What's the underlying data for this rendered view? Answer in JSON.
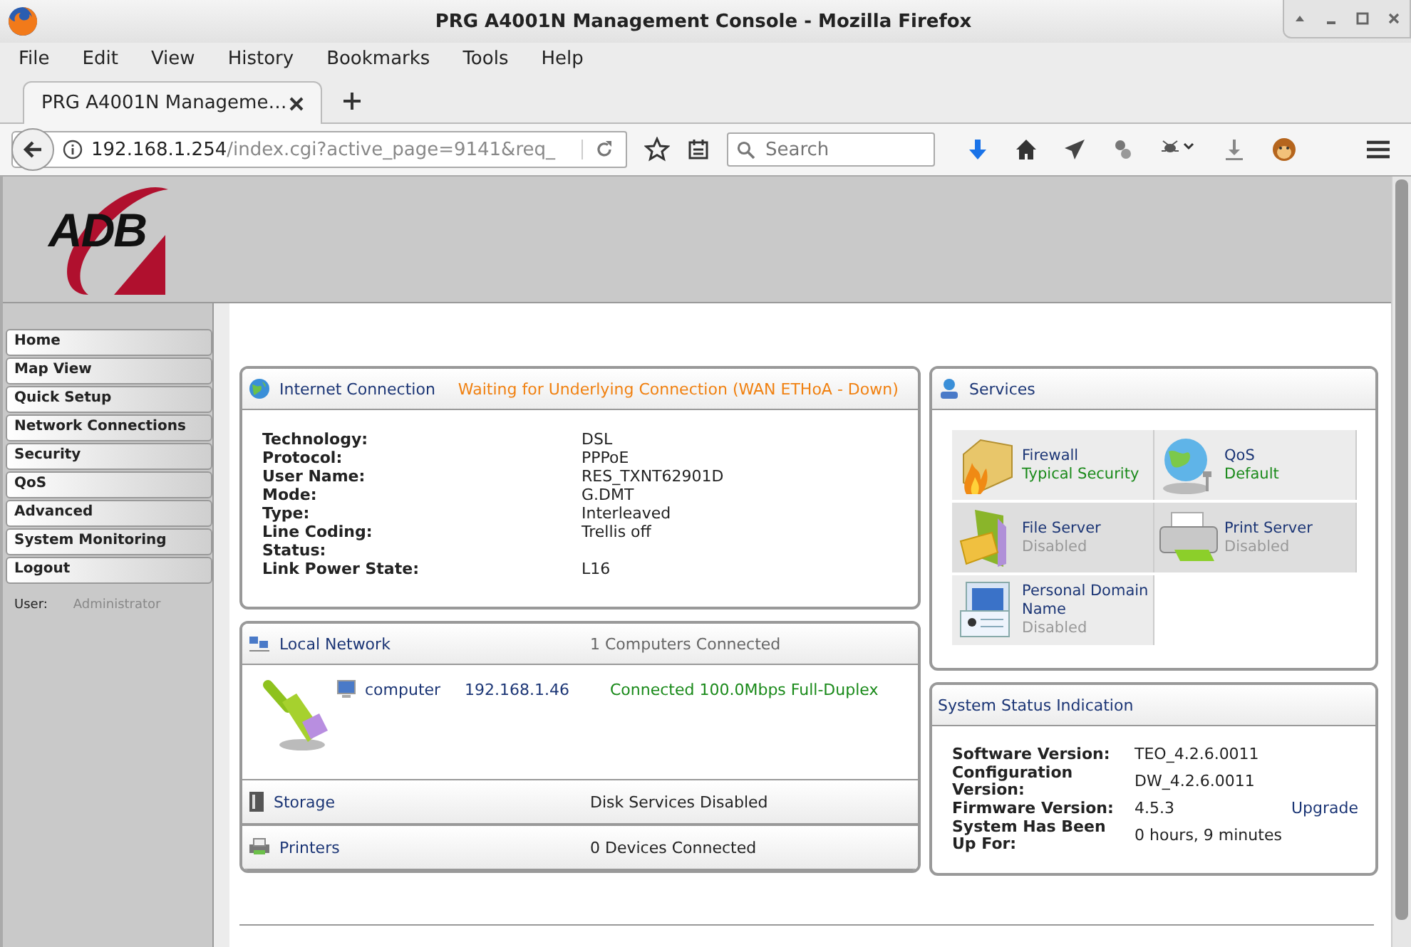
{
  "window": {
    "title": "PRG A4001N Management Console - Mozilla Firefox"
  },
  "menu": [
    "File",
    "Edit",
    "View",
    "History",
    "Bookmarks",
    "Tools",
    "Help"
  ],
  "tabs": [
    {
      "label": "PRG A4001N Manageme…",
      "selected": true
    }
  ],
  "address": {
    "host": "192.168.1.254",
    "path": "/index.cgi?active_page=9141&req_"
  },
  "search": {
    "placeholder": "Search"
  },
  "logo": "ADB",
  "sidebar": {
    "items": [
      "Home",
      "Map View",
      "Quick Setup",
      "Network Connections",
      "Security",
      "QoS",
      "Advanced",
      "System Monitoring",
      "Logout"
    ],
    "user_label": "User:",
    "user": "Administrator"
  },
  "internet": {
    "title": "Internet Connection",
    "status": "Waiting for Underlying Connection (WAN ETHoA - Down)",
    "fields": [
      {
        "label": "Technology:",
        "value": "DSL"
      },
      {
        "label": "Protocol:",
        "value": "PPPoE"
      },
      {
        "label": "User Name:",
        "value": "RES_TXNT62901D"
      },
      {
        "label": "Mode:",
        "value": "G.DMT"
      },
      {
        "label": "Type:",
        "value": "Interleaved"
      },
      {
        "label": "Line Coding:",
        "value": "Trellis off"
      },
      {
        "label": "Status:"
      },
      {
        "label": "Link Power State:",
        "value": "L16"
      }
    ]
  },
  "local_network": {
    "title": "Local Network",
    "summary": "1 Computers Connected",
    "devices": [
      {
        "name": "computer",
        "ip": "192.168.1.46",
        "status": "Connected 100.0Mbps Full-Duplex"
      }
    ]
  },
  "storage": {
    "title": "Storage",
    "summary": "Disk Services Disabled"
  },
  "printers": {
    "title": "Printers",
    "summary": "0 Devices Connected"
  },
  "services": {
    "title": "Services",
    "items": [
      {
        "kind": "firewall",
        "name": "Firewall",
        "status": "Typical Security",
        "enabled": true
      },
      {
        "kind": "qos",
        "name": "QoS",
        "status": "Default",
        "enabled": true
      },
      {
        "kind": "file",
        "name": "File Server",
        "status": "Disabled",
        "enabled": false
      },
      {
        "kind": "print",
        "name": "Print Server",
        "status": "Disabled",
        "enabled": false
      },
      {
        "kind": "domain",
        "name": "Personal Domain Name",
        "status": "Disabled",
        "enabled": false
      }
    ]
  },
  "system_status": {
    "title": "System Status Indication",
    "fields": [
      {
        "label": "Software Version:",
        "value": "TEO_4.2.6.0011"
      },
      {
        "label": "Configuration Version:",
        "value": "DW_4.2.6.0011"
      },
      {
        "label": "Firmware Version:",
        "value": "4.5.3",
        "link": "Upgrade"
      },
      {
        "label": "System Has Been Up For:",
        "value": "0 hours, 9 minutes"
      }
    ]
  }
}
